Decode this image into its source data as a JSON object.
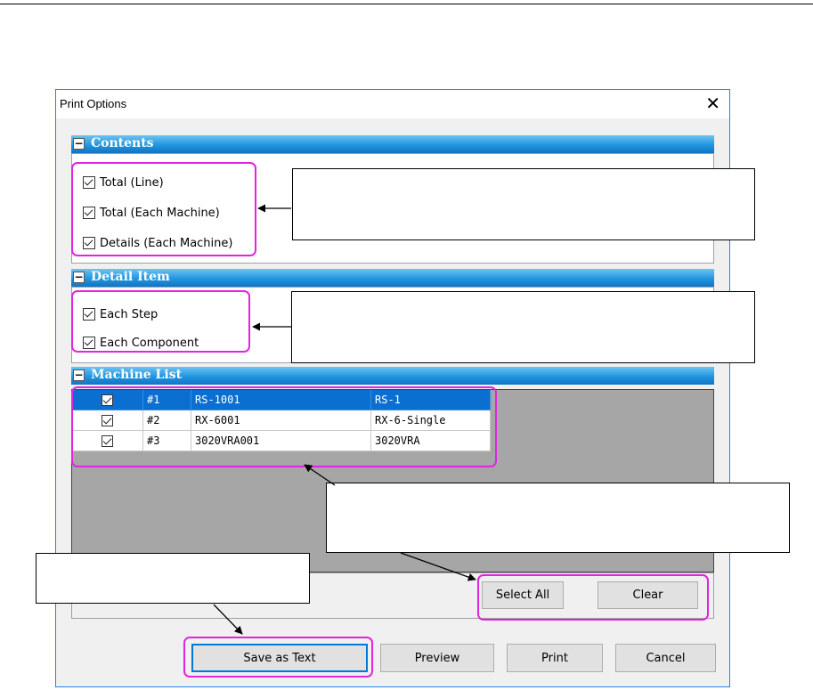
{
  "dialog": {
    "title": "Print Options",
    "close_symbol": "✕"
  },
  "sections": {
    "contents": {
      "title": "Contents",
      "items": [
        {
          "label": "Total (Line)",
          "checked": true
        },
        {
          "label": "Total (Each Machine)",
          "checked": true
        },
        {
          "label": "Details (Each Machine)",
          "checked": true
        }
      ]
    },
    "detail_item": {
      "title": "Detail Item",
      "items": [
        {
          "label": "Each Step",
          "checked": true
        },
        {
          "label": "Each Component",
          "checked": true
        }
      ]
    },
    "machine_list": {
      "title": "Machine List",
      "rows": [
        {
          "num": "#1",
          "name": "RS-1001",
          "model": "RS-1",
          "checked": true,
          "selected": true
        },
        {
          "num": "#2",
          "name": "RX-6001",
          "model": "RX-6-Single",
          "checked": true,
          "selected": false
        },
        {
          "num": "#3",
          "name": "3020VRA001",
          "model": "3020VRA",
          "checked": true,
          "selected": false
        }
      ]
    }
  },
  "buttons": {
    "select_all": "Select All",
    "clear": "Clear",
    "save_as_text": "Save as Text",
    "preview": "Preview",
    "print": "Print",
    "cancel": "Cancel"
  },
  "colors": {
    "section_header": "#2196e0",
    "highlight": "#e025e0",
    "selection": "#0a6fd1"
  },
  "icons": {
    "collapse": "minus-icon",
    "close": "close-icon",
    "checkbox": "checkbox-checked-icon"
  }
}
